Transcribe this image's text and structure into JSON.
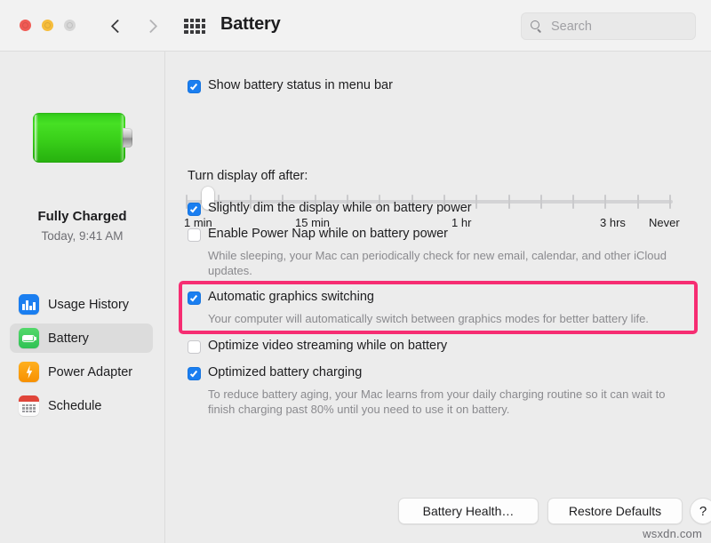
{
  "window": {
    "title": "Battery",
    "traffic_lights": [
      "close",
      "minimize",
      "zoom"
    ],
    "nav_back": "‹",
    "nav_forward": "›",
    "grid_icon": "apps-grid-icon"
  },
  "search": {
    "placeholder": "Search",
    "value": "",
    "icon": "search-icon"
  },
  "sidebar": {
    "battery_graphic": "battery-full-green-icon",
    "status": "Fully Charged",
    "timestamp": "Today, 9:41 AM",
    "items": [
      {
        "label": "Usage History",
        "icon": "bar-chart-icon",
        "selected": false
      },
      {
        "label": "Battery",
        "icon": "battery-icon",
        "selected": true
      },
      {
        "label": "Power Adapter",
        "icon": "lightning-bolt-icon",
        "selected": false
      },
      {
        "label": "Schedule",
        "icon": "calendar-icon",
        "selected": false
      }
    ]
  },
  "main": {
    "show_battery_status": {
      "label": "Show battery status in menu bar",
      "checked": true
    },
    "display_off": {
      "label": "Turn display off after:",
      "slider": {
        "ticks": 16,
        "knob_position_index": 1,
        "tick_labels": [
          "1 min",
          "15 min",
          "1 hr",
          "3 hrs",
          "Never"
        ]
      }
    },
    "options": [
      {
        "label": "Slightly dim the display while on battery power",
        "checked": true,
        "description": ""
      },
      {
        "label": "Enable Power Nap while on battery power",
        "checked": false,
        "description": "While sleeping, your Mac can periodically check for new email, calendar, and other iCloud updates."
      },
      {
        "label": "Automatic graphics switching",
        "checked": true,
        "description": "Your computer will automatically switch between graphics modes for better battery life.",
        "highlighted": true
      },
      {
        "label": "Optimize video streaming while on battery",
        "checked": false,
        "description": ""
      },
      {
        "label": "Optimized battery charging",
        "checked": true,
        "description": "To reduce battery aging, your Mac learns from your daily charging routine so it can wait to finish charging past 80% until you need to use it on battery."
      }
    ]
  },
  "footer": {
    "battery_health_label": "Battery Health…",
    "restore_defaults_label": "Restore Defaults",
    "help_label": "?"
  },
  "watermark": "wsxdn.com",
  "colors": {
    "accent_blue": "#1a7ef0",
    "highlight_pink": "#f62d72",
    "battery_green": "#3ad41e",
    "window_bg": "#ececec",
    "titlebar_bg": "#f2f2f2"
  }
}
